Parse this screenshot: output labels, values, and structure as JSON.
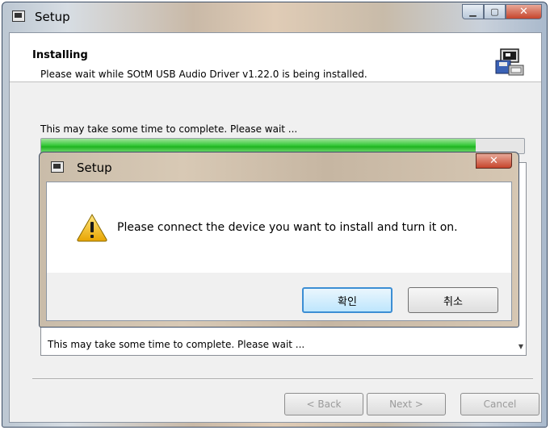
{
  "window": {
    "title": "Setup"
  },
  "header": {
    "title": "Installing",
    "subtitle": "Please wait while SOtM USB Audio Driver v1.22.0 is being installed."
  },
  "status_text": "This may take some time to complete. Please wait ...",
  "progress_fraction": 0.9,
  "log": {
    "last_line": "This may take some time to complete. Please wait ..."
  },
  "buttons": {
    "back": "< Back",
    "next": "Next >",
    "cancel": "Cancel"
  },
  "dialog": {
    "title": "Setup",
    "message": "Please connect the device you want to install and turn it on.",
    "ok_label": "확인",
    "cancel_label": "취소"
  },
  "colors": {
    "progress_fill": "#1fb321",
    "close_button": "#c6452c",
    "default_button_border": "#3c8ed4"
  },
  "icons": [
    "app-icon",
    "installer-icon",
    "warning-icon",
    "close-icon",
    "minimize-icon",
    "maximize-icon"
  ]
}
